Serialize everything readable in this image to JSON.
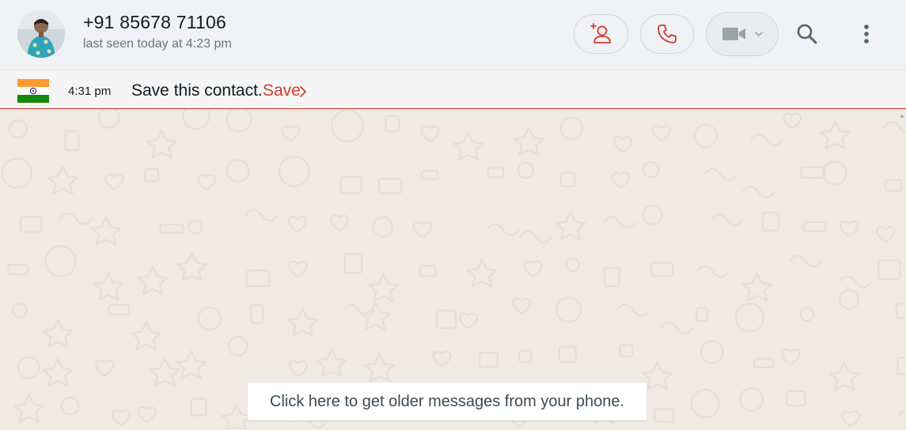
{
  "header": {
    "contact_name": "+91 85678 71106",
    "last_seen": "last seen today at 4:23 pm",
    "avatar_icon": "contact-photo",
    "buttons": {
      "add_contact_icon": "add-contact-icon",
      "call_icon": "phone-icon",
      "video_icon": "video-camera-icon",
      "video_dropdown_icon": "chevron-down-icon",
      "search_icon": "search-icon",
      "menu_icon": "kebab-menu-icon"
    }
  },
  "banner": {
    "flag": "india-flag",
    "time": "4:31 pm",
    "message": "Save this contact.",
    "save_label": "Save",
    "save_chevron_icon": "chevron-right-icon"
  },
  "chat": {
    "older_messages_label": "Click here to get older messages from your phone."
  },
  "colors": {
    "accent_red": "#d13b2f",
    "header_bg": "#f0f2f5",
    "chat_bg": "#efeae2",
    "flag_saffron": "#ff9933",
    "flag_white": "#ffffff",
    "flag_green": "#138808",
    "flag_chakra": "#000080"
  }
}
